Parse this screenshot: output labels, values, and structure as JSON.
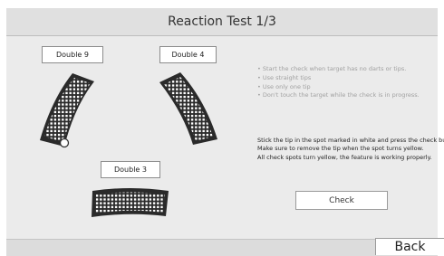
{
  "header": {
    "title": "Reaction Test 1/3"
  },
  "targets": [
    {
      "id": "double-9",
      "label": "Double 9",
      "status": "pending"
    },
    {
      "id": "double-4",
      "label": "Double 4",
      "status": "pending"
    },
    {
      "id": "double-3",
      "label": "Double 3",
      "status": "pending"
    }
  ],
  "instructions": [
    "Start the check when target has no darts or tips.",
    "Use straight tips",
    "Use only one tip",
    "Don't touch the target while the check is in progress."
  ],
  "body_lines": [
    "Stick the tip in the spot marked in white and press the check button.",
    "Make sure to remove the tip when the spot turns yellow.",
    "All check spots turn yellow, the feature is working properly."
  ],
  "buttons": {
    "check": "Check",
    "back": "Back"
  },
  "colors": {
    "segment_fill": "#2a2a2a",
    "hole": "#ffffff",
    "marker": "#ffffff",
    "checked_spot": "#f2d200"
  }
}
